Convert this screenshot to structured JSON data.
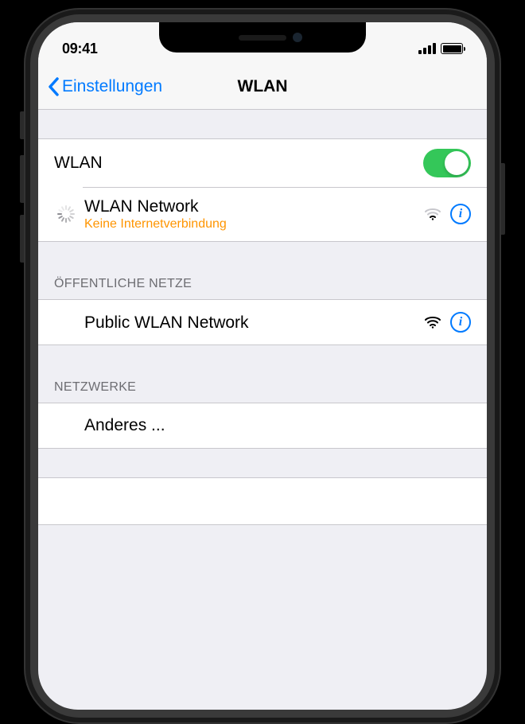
{
  "status": {
    "time": "09:41"
  },
  "nav": {
    "back_label": "Einstellungen",
    "title": "WLAN"
  },
  "wlan_toggle": {
    "label": "WLAN",
    "on": true
  },
  "connected": {
    "name": "WLAN Network",
    "status": "Keine Internetverbindung"
  },
  "sections": {
    "public_header": "ÖFFENTLICHE NETZE",
    "networks_header": "NETZWERKE"
  },
  "public_network": {
    "name": "Public WLAN Network"
  },
  "other": {
    "label": "Anderes ..."
  }
}
